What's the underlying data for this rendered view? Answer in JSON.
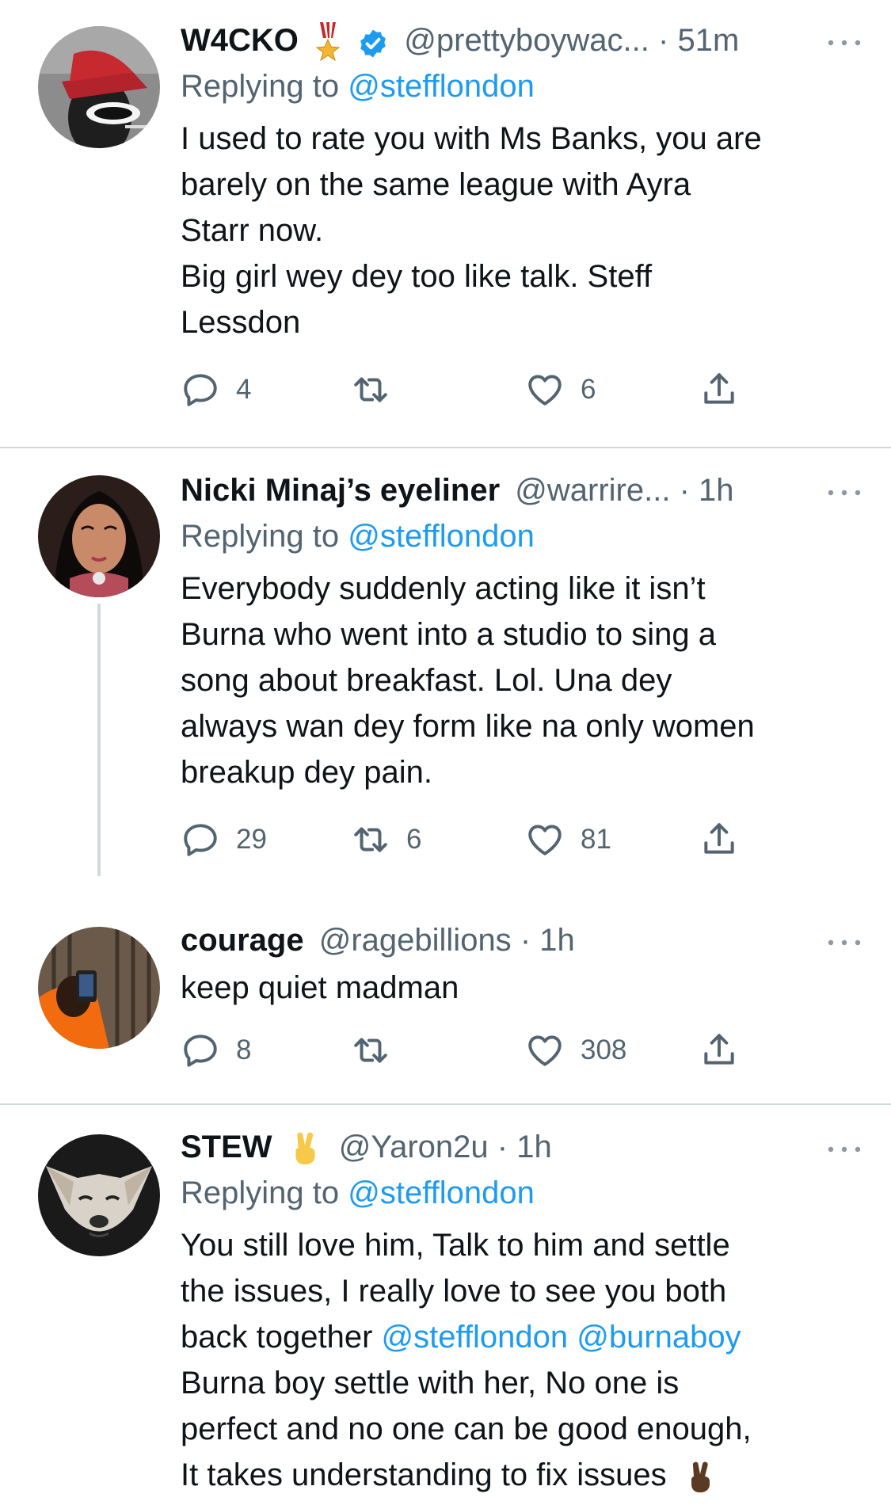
{
  "tweets": [
    {
      "name": "W4CKO",
      "handle": "@prettyboywac...",
      "time": "51m",
      "replying_label": "Replying to",
      "replying_to": "@stefflondon",
      "lines": [
        "I used to rate you with Ms Banks, you are",
        "barely on the same league with Ayra",
        "Starr now.",
        "Big girl wey dey too like talk. Steff",
        "Lessdon"
      ],
      "replies": "4",
      "retweets": "",
      "likes": "6"
    },
    {
      "name": "Nicki Minaj’s eyeliner",
      "handle": "@warrire...",
      "time": "1h",
      "replying_label": "Replying to",
      "replying_to": "@stefflondon",
      "lines": [
        "Everybody suddenly acting like it isn’t",
        "Burna who went into a studio to sing a",
        "song about breakfast. Lol. Una dey",
        "always wan dey form like na only women",
        "breakup dey pain."
      ],
      "replies": "29",
      "retweets": "6",
      "likes": "81"
    },
    {
      "name": "courage",
      "handle": "@ragebillions",
      "time": "1h",
      "lines": [
        "keep quiet madman"
      ],
      "replies": "8",
      "retweets": "",
      "likes": "308"
    },
    {
      "name": "STEW",
      "handle": "@Yaron2u",
      "time": "1h",
      "replying_label": "Replying to",
      "replying_to": "@stefflondon",
      "lines": [
        "You still love him, Talk to him and settle",
        "the issues, I really love to see you both"
      ],
      "line3_text": "back together",
      "line3_mention1": "@stefflondon",
      "line3_mention2": "@burnaboy",
      "lines_after": [
        "Burna boy settle with her, No one is",
        "perfect and no one can be good enough,"
      ],
      "last_line": "It takes understanding to fix issues"
    }
  ],
  "separator": "·",
  "icons": [
    "medal-icon",
    "verified-badge-icon",
    "more-icon",
    "reply-icon",
    "retweet-icon",
    "like-icon",
    "share-icon",
    "victory-hand-emoji"
  ],
  "colors": {
    "link": "#1d9bf0",
    "muted": "#536471",
    "verified": "#1d9bf0",
    "divider": "#cfd9de"
  }
}
